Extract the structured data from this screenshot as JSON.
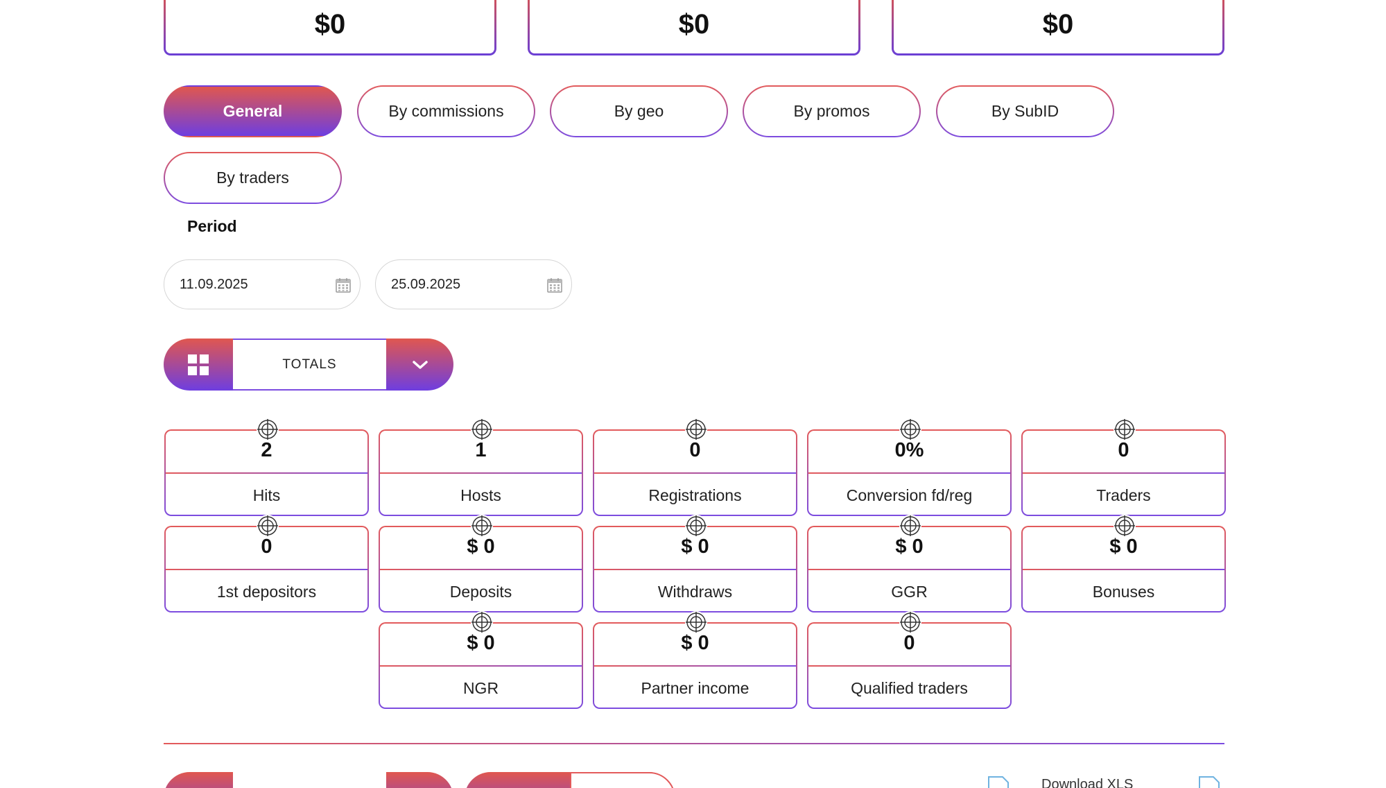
{
  "summary": {
    "cards": [
      {
        "value": "$0"
      },
      {
        "value": "$0"
      },
      {
        "value": "$0"
      }
    ]
  },
  "tabs": [
    {
      "label": "General",
      "active": true
    },
    {
      "label": "By commissions",
      "active": false
    },
    {
      "label": "By geo",
      "active": false
    },
    {
      "label": "By promos",
      "active": false
    },
    {
      "label": "By SubID",
      "active": false
    },
    {
      "label": "By traders",
      "active": false
    }
  ],
  "period": {
    "label": "Period",
    "from": "11.09.2025",
    "to": "25.09.2025"
  },
  "view_selector": {
    "selected": "TOTALS"
  },
  "metrics": [
    {
      "value": "2",
      "label": "Hits"
    },
    {
      "value": "1",
      "label": "Hosts"
    },
    {
      "value": "0",
      "label": "Registrations"
    },
    {
      "value": "0%",
      "label": "Conversion fd/reg"
    },
    {
      "value": "0",
      "label": "Traders"
    },
    {
      "value": "0",
      "label": "1st depositors"
    },
    {
      "value": "$ 0",
      "label": "Deposits"
    },
    {
      "value": "$ 0",
      "label": "Withdraws"
    },
    {
      "value": "$ 0",
      "label": "GGR"
    },
    {
      "value": "$ 0",
      "label": "Bonuses"
    },
    {
      "value": "$ 0",
      "label": "NGR"
    },
    {
      "value": "$ 0",
      "label": "Partner income"
    },
    {
      "value": "0",
      "label": "Qualified traders"
    }
  ],
  "footer": {
    "download_label": "Download XLS"
  },
  "colors": {
    "accent_start": "#e0574f",
    "accent_end": "#6e3ee0"
  }
}
